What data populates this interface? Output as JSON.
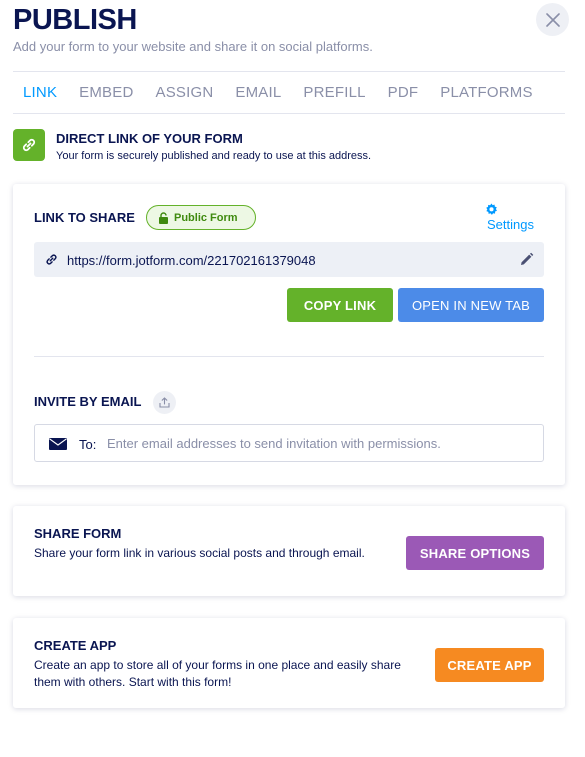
{
  "header": {
    "title": "PUBLISH",
    "subtitle": "Add your form to your website and share it on social platforms."
  },
  "tabs": [
    {
      "label": "LINK",
      "active": true
    },
    {
      "label": "EMBED"
    },
    {
      "label": "ASSIGN"
    },
    {
      "label": "EMAIL"
    },
    {
      "label": "PREFILL"
    },
    {
      "label": "PDF"
    },
    {
      "label": "PLATFORMS"
    }
  ],
  "direct": {
    "title": "DIRECT LINK OF YOUR FORM",
    "subtitle": "Your form is securely published and ready to use at this address."
  },
  "link_card": {
    "label": "LINK TO SHARE",
    "badge": "Public Form",
    "settings_label": "Settings",
    "url": "https://form.jotform.com/221702161379048",
    "copy_label": "COPY LINK",
    "open_label": "OPEN IN NEW TAB"
  },
  "invite": {
    "label": "INVITE BY EMAIL",
    "to_label": "To:",
    "placeholder": "Enter email addresses to send invitation with permissions."
  },
  "share_card": {
    "title": "SHARE FORM",
    "description": "Share your form link in various social posts and through email.",
    "button": "SHARE OPTIONS"
  },
  "app_card": {
    "title": "CREATE APP",
    "description": "Create an app to store all of your forms in one place and easily share them with others. Start with this form!",
    "button": "CREATE APP"
  },
  "colors": {
    "navy": "#0a1551",
    "accent_blue": "#0099ff",
    "green": "#64b22a",
    "button_blue": "#4c8be8",
    "purple": "#9b59b6",
    "orange": "#f68a21"
  },
  "icons": [
    "close-icon",
    "link-icon",
    "lock-icon",
    "gear-icon",
    "edit-icon",
    "upload-icon",
    "mail-icon"
  ]
}
